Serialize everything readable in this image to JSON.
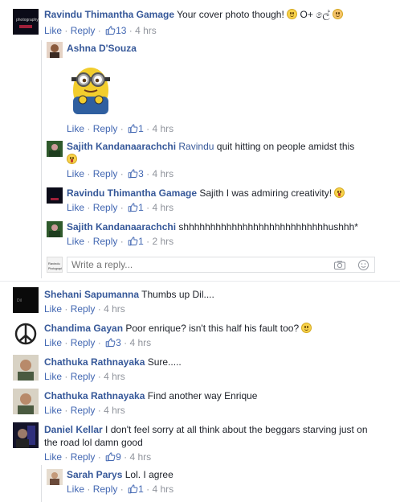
{
  "labels": {
    "like": "Like",
    "reply": "Reply",
    "dot": "·",
    "sep": "·"
  },
  "colors": {
    "link": "#365899",
    "action": "#4267b2",
    "meta": "#90949c",
    "divider": "#dddfe2"
  },
  "comments": [
    {
      "name": "Ravindu Thimantha Gamage",
      "mention": "",
      "text": "Your cover photo though!",
      "text_after": "O+ ලේ",
      "emoji": "smile-icon",
      "emoji2": "blush-icon",
      "likes": "13",
      "time": "4 hrs"
    },
    {
      "name": "Ashna D'Souza",
      "mention": "",
      "text": "",
      "sticker": "minion-sticker",
      "likes": "1",
      "time": "4 hrs"
    },
    {
      "name": "Sajith Kandanaarachchi",
      "mention": "Ravindu",
      "text": "quit hitting on people amidst this",
      "emoji": "tongue-icon",
      "likes": "3",
      "time": "4 hrs"
    },
    {
      "name": "Ravindu Thimantha Gamage",
      "mention": "",
      "text": "Sajith I was admiring creativity!",
      "emoji": "tongue-icon",
      "likes": "1",
      "time": "4 hrs"
    },
    {
      "name": "Sajith Kandanaarachchi",
      "mention": "",
      "text": "shhhhhhhhhhhhhhhhhhhhhhhhhhhushhh*",
      "likes": "1",
      "time": "2 hrs"
    },
    {
      "name": "Shehani Sapumanna",
      "mention": "",
      "text": "Thumbs up Dil....",
      "likes": "",
      "time": "4 hrs"
    },
    {
      "name": "Chandima Gayan",
      "mention": "",
      "text": "Poor enrique? isn't this half his fault too?",
      "emoji": "smile-icon",
      "likes": "3",
      "time": "4 hrs"
    },
    {
      "name": "Chathuka Rathnayaka",
      "mention": "",
      "text": "Sure.....",
      "likes": "",
      "time": "4 hrs"
    },
    {
      "name": "Chathuka Rathnayaka",
      "mention": "",
      "text": "Find another way Enrique",
      "likes": "",
      "time": "4 hrs"
    },
    {
      "name": "Daniel Kellar",
      "mention": "",
      "text": "I don't feel sorry at all think about the beggars starving just on the road lol damn good",
      "likes": "9",
      "time": "4 hrs"
    },
    {
      "name": "Sarah Parys",
      "mention": "",
      "text": "Lol. I agree",
      "likes": "1",
      "time": "4 hrs"
    }
  ],
  "reply_box": {
    "placeholder": "Write a reply...",
    "camera_icon": "camera-icon",
    "emoji_icon": "emoji-icon",
    "avatar_text": "Ravindu Photography"
  }
}
